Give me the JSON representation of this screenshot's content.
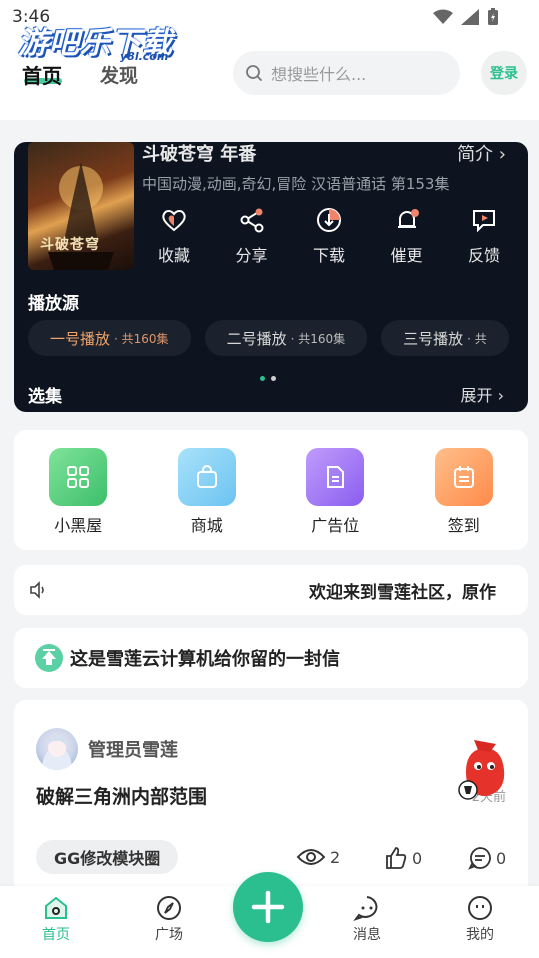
{
  "status_bar": {
    "time": "3:46"
  },
  "header": {
    "logo": "游吧乐下载",
    "logo_sub": "y8l.com",
    "tabs": [
      {
        "label": "首页",
        "active": true
      },
      {
        "label": "发现",
        "active": false
      }
    ],
    "search_placeholder": "想搜些什么...",
    "login_label": "登录"
  },
  "anime": {
    "title": "斗破苍穹 年番",
    "intro_label": "简介",
    "poster_text": "斗破苍穹",
    "meta": "中国动漫,动画,奇幻,冒险 汉语普通话 第153集",
    "actions": [
      {
        "label": "收藏",
        "icon": "heart-icon"
      },
      {
        "label": "分享",
        "icon": "share-icon"
      },
      {
        "label": "下载",
        "icon": "download-icon"
      },
      {
        "label": "催更",
        "icon": "bell-icon"
      },
      {
        "label": "反馈",
        "icon": "feedback-icon"
      }
    ],
    "source_title": "播放源",
    "sources": [
      {
        "name": "一号播放",
        "count": "· 共160集"
      },
      {
        "name": "二号播放",
        "count": "· 共160集"
      },
      {
        "name": "三号播放",
        "count": "· 共"
      }
    ],
    "episodes_title": "选集",
    "expand_label": "展开"
  },
  "quick_entries": [
    {
      "label": "小黑屋",
      "icon": "grid-icon",
      "color": "#4fcf7a"
    },
    {
      "label": "商城",
      "icon": "shop-bag-icon",
      "color": "#7fcdf2"
    },
    {
      "label": "广告位",
      "icon": "document-icon",
      "color": "#a070f0"
    },
    {
      "label": "签到",
      "icon": "calendar-icon",
      "color": "#ff9a5a"
    }
  ],
  "notice": {
    "text": "欢迎来到雪莲社区，原作"
  },
  "letter": {
    "text": "这是雪莲云计算机给你留的一封信"
  },
  "post": {
    "author": "管理员雪莲",
    "title": "破解三角洲内部范围",
    "time": "2天前",
    "tag": "GG修改模块圈",
    "views": "2",
    "likes": "0",
    "comments": "0"
  },
  "bottom_nav": [
    {
      "label": "首页",
      "icon": "home-icon",
      "active": true
    },
    {
      "label": "广场",
      "icon": "compass-icon",
      "active": false
    },
    {
      "label": "消息",
      "icon": "message-icon",
      "active": false
    },
    {
      "label": "我的",
      "icon": "profile-icon",
      "active": false
    }
  ],
  "colors": {
    "accent": "#2bbf8f",
    "dark_card": "#0d1420"
  }
}
